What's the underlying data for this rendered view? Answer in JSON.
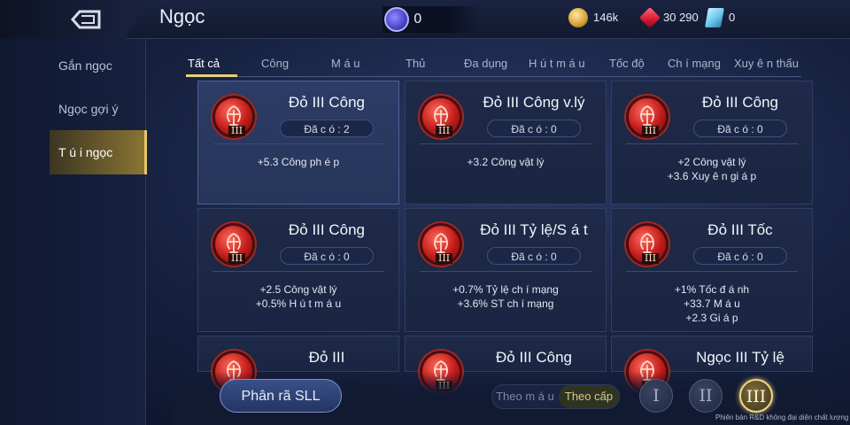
{
  "header": {
    "title": "Ngọc",
    "gem_count": "0",
    "gold": "146k",
    "rubies": "30 290",
    "tickets": "0"
  },
  "sidebar": {
    "items": [
      {
        "label": "Gắn ngọc"
      },
      {
        "label": "Ngọc gợi ý"
      },
      {
        "label": "T ú i ngọc"
      }
    ],
    "active_index": 2
  },
  "tabs": [
    {
      "label": "Tất cả"
    },
    {
      "label": "Công"
    },
    {
      "label": "M á u"
    },
    {
      "label": "Thủ"
    },
    {
      "label": "Đa dụng"
    },
    {
      "label": "H ú t m á u"
    },
    {
      "label": "Tốc độ"
    },
    {
      "label": "Ch í  mạng"
    },
    {
      "label": "Xuy ê n thấu"
    }
  ],
  "cards": [
    {
      "name": "Đỏ III Công",
      "owned": "Đã c ó : 2",
      "stats": [
        "+5.3 Công ph é p"
      ],
      "tier": "III",
      "selected": true
    },
    {
      "name": "Đỏ III Công v.lý",
      "owned": "Đã c ó : 0",
      "stats": [
        "+3.2 Công vật lý"
      ],
      "tier": "III"
    },
    {
      "name": "Đỏ III Công",
      "owned": "Đã c ó : 0",
      "stats": [
        "+2 Công vật lý",
        "+3.6 Xuy ê n gi á p"
      ],
      "tier": "III"
    },
    {
      "name": "Đỏ III Công",
      "owned": "Đã c ó : 0",
      "stats": [
        "+2.5 Công vật lý",
        "+0.5% H ú t m á u"
      ],
      "tier": "III"
    },
    {
      "name": "Đỏ III Tỷ lệ/S á t",
      "owned": "Đã c ó : 0",
      "stats": [
        "+0.7% Tỷ lệ ch í  mạng",
        "+3.6% ST ch í  mạng"
      ],
      "tier": "III"
    },
    {
      "name": "Đỏ III Tốc",
      "owned": "Đã c ó : 0",
      "stats": [
        "+1% Tốc đ á nh",
        "+33.7 M á u",
        "+2.3 Gi á p"
      ],
      "tier": "III"
    },
    {
      "name": "Đỏ III",
      "owned": "",
      "stats": [],
      "tier": "III"
    },
    {
      "name": "Đỏ III Công",
      "owned": "",
      "stats": [],
      "tier": "III"
    },
    {
      "name": "Ngọc III Tỷ lệ",
      "owned": "",
      "stats": [],
      "tier": "III"
    }
  ],
  "bottom": {
    "decompose_label": "Phân rã SLL",
    "sort_by_color": "Theo m á u",
    "sort_by_level": "Theo cấp",
    "tier_buttons": [
      "I",
      "II",
      "III"
    ],
    "active_tier": 2,
    "footer_note": "Phiên bản R&D không đại diện chất lượng cuối"
  },
  "colors": {
    "accent_gold": "#e8d07a",
    "gem_red": "#c21b1b",
    "panel_bg": "#1a2542"
  }
}
